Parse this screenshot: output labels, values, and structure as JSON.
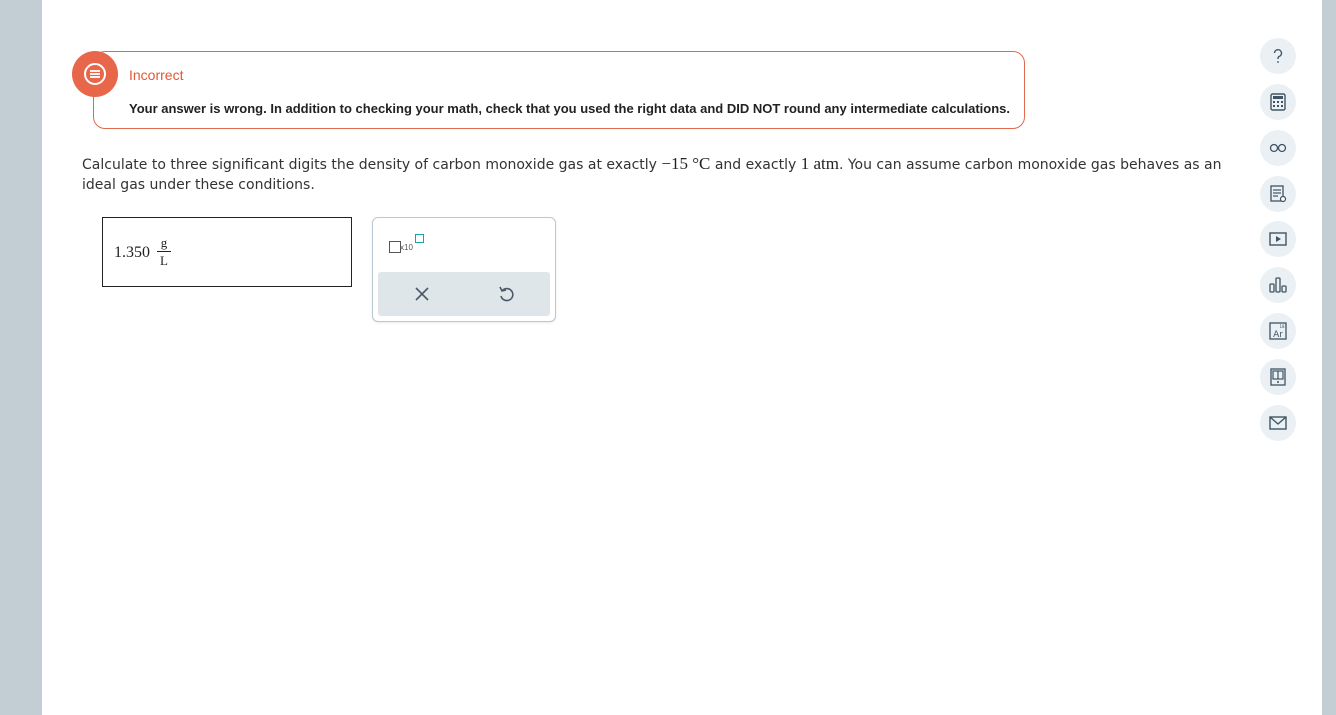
{
  "feedback": {
    "title": "Incorrect",
    "message": "Your answer is wrong. In addition to checking your math, check that you used the right data and DID NOT round any intermediate calculations."
  },
  "question": {
    "text_1": "Calculate to three significant digits the density of carbon monoxide gas at exactly ",
    "temperature": "−15 °C",
    "text_2": " and exactly ",
    "pressure": "1 atm",
    "text_3": ". You can assume carbon monoxide gas behaves as an ideal gas under these conditions."
  },
  "answer": {
    "value": "1.350",
    "unit_numerator": "g",
    "unit_denominator": "L"
  },
  "palette": {
    "sci_label": "x10"
  },
  "colors": {
    "accent": "#e8664a",
    "teal": "#13a6a6"
  },
  "toolbar_icons": [
    "help-icon",
    "calculator-icon",
    "glasses-icon",
    "notes-icon",
    "video-icon",
    "chart-icon",
    "periodic-table-icon",
    "reference-icon",
    "mail-icon"
  ]
}
